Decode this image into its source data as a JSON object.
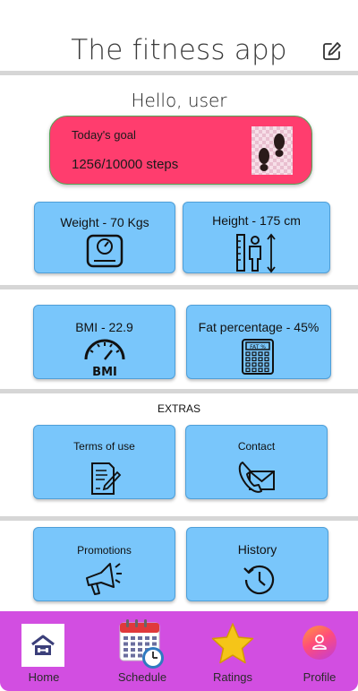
{
  "header": {
    "title": "The fitness app",
    "edit_icon": "edit-icon"
  },
  "greeting": "Hello, user",
  "goal": {
    "label": "Today's goal",
    "value": "1256/10000 steps",
    "icon": "footprints-icon"
  },
  "stats": {
    "weight": {
      "label": "Weight  - 70 Kgs",
      "icon": "weighing-scale-icon"
    },
    "height": {
      "label": "Height - 175 cm",
      "icon": "height-measure-icon"
    },
    "bmi": {
      "label": "BMI - 22.9",
      "icon": "bmi-gauge-icon",
      "icon_text": "BMI"
    },
    "fat": {
      "label": "Fat percentage - 45%",
      "icon": "fat-calculator-icon",
      "icon_text": "FAT %"
    }
  },
  "extras": {
    "heading": "EXTRAS",
    "terms": {
      "label": "Terms of use",
      "icon": "document-pen-icon"
    },
    "contact": {
      "label": "Contact",
      "icon": "phone-envelope-icon"
    },
    "promotions": {
      "label": "Promotions",
      "icon": "megaphone-icon"
    },
    "history": {
      "label": "History",
      "icon": "history-clock-icon"
    }
  },
  "nav": {
    "items": [
      {
        "label": "Home",
        "icon": "home-icon"
      },
      {
        "label": "Schedule",
        "icon": "calendar-clock-icon"
      },
      {
        "label": "Ratings",
        "icon": "star-icon"
      },
      {
        "label": "Profile",
        "icon": "profile-icon"
      }
    ]
  },
  "colors": {
    "goal_card": "#ff3d6e",
    "tile": "#79c6fb",
    "nav_bar": "#d24ee1",
    "divider": "#d6d6d6"
  }
}
